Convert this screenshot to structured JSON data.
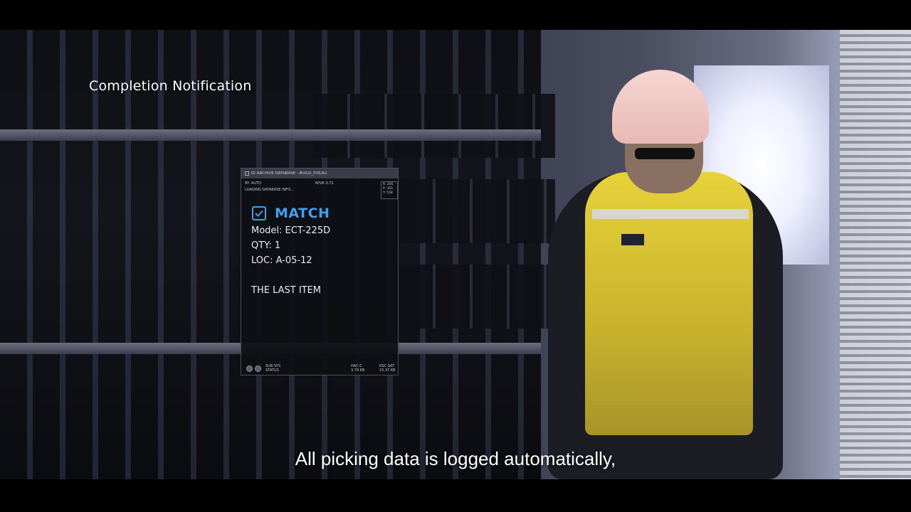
{
  "hud": {
    "title": "Completion Notification"
  },
  "panel": {
    "titlebar": "ID ARCHIVE DATABASE - BUILD_035/A1",
    "meta_left": "BY: AUTO",
    "meta_center": "M/VR 0.72",
    "meta_box": [
      "R: 205",
      "P: 301",
      "Y: 558"
    ],
    "loading": "LOADING DATABASE INFO...",
    "status": "MATCH",
    "status_color": "#3fa0f0",
    "status_icon": "checkbox-checked-icon",
    "model": "Model: ECT-225D",
    "qty": "QTY: 1",
    "loc": "LOC: A-05-12",
    "note": "THE LAST ITEM",
    "footer": {
      "sub_sys": "SUB SYS",
      "status": "STATUS",
      "hac_label": "HAC-C",
      "hac_value": "3.79 KB",
      "ksc_label": "KSC SAT",
      "ksc_value": "15.37 KB"
    }
  },
  "subtitle": "All picking data is logged automatically,"
}
